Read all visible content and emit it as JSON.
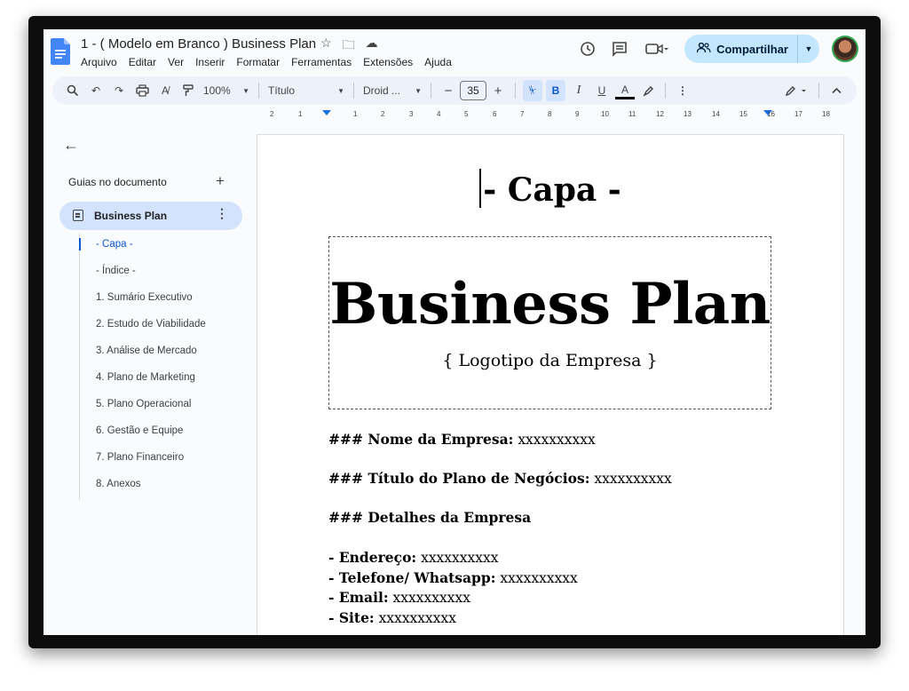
{
  "document": {
    "title": "1 - ( Modelo em Branco ) Business Plan"
  },
  "menu": [
    "Arquivo",
    "Editar",
    "Ver",
    "Inserir",
    "Formatar",
    "Ferramentas",
    "Extensões",
    "Ajuda"
  ],
  "header": {
    "share_label": "Compartilhar"
  },
  "toolbar": {
    "zoom": "100%",
    "style": "Título",
    "font": "Droid ...",
    "font_size": "35",
    "bold": "B",
    "italic": "I",
    "underline": "U",
    "text_color": "A"
  },
  "ruler": {
    "ticks": [
      "2",
      "1",
      "1",
      "2",
      "3",
      "4",
      "5",
      "6",
      "7",
      "8",
      "9",
      "10",
      "11",
      "12",
      "13",
      "14",
      "15",
      "16",
      "17",
      "18"
    ]
  },
  "sidebar": {
    "heading": "Guias no documento",
    "tab_label": "Business Plan",
    "outline": [
      "- Capa -",
      "- Índice -",
      "1. Sumário Executivo",
      "2. Estudo de Viabilidade",
      "3. Análise de Mercado",
      "4. Plano de Marketing",
      "5. Plano Operacional",
      "6. Gestão e Equipe",
      "7. Plano Financeiro",
      "8. Anexos"
    ]
  },
  "page": {
    "heading": "- Capa -",
    "cover_title": "Business Plan",
    "logo_placeholder": "{ Logotipo da Empresa }",
    "lines": [
      {
        "label": "### Nome da Empresa:",
        "value": "xxxxxxxxxx"
      },
      {
        "label": "### Título do Plano de Negócios:",
        "value": "xxxxxxxxxx"
      },
      {
        "label": "### Detalhes da Empresa",
        "value": ""
      },
      {
        "label": "- Endereço:",
        "value": "xxxxxxxxxx"
      },
      {
        "label": "- Telefone/ Whatsapp:",
        "value": "xxxxxxxxxx"
      },
      {
        "label": "- Email:",
        "value": "xxxxxxxxxx"
      },
      {
        "label": "- Site:",
        "value": "xxxxxxxxxx"
      }
    ]
  },
  "colors": {
    "accent": "#0b57d0",
    "share_bg": "#c2e7ff",
    "toolbar_bg": "#edf2fa",
    "sidebar_active": "#d3e3fd"
  }
}
